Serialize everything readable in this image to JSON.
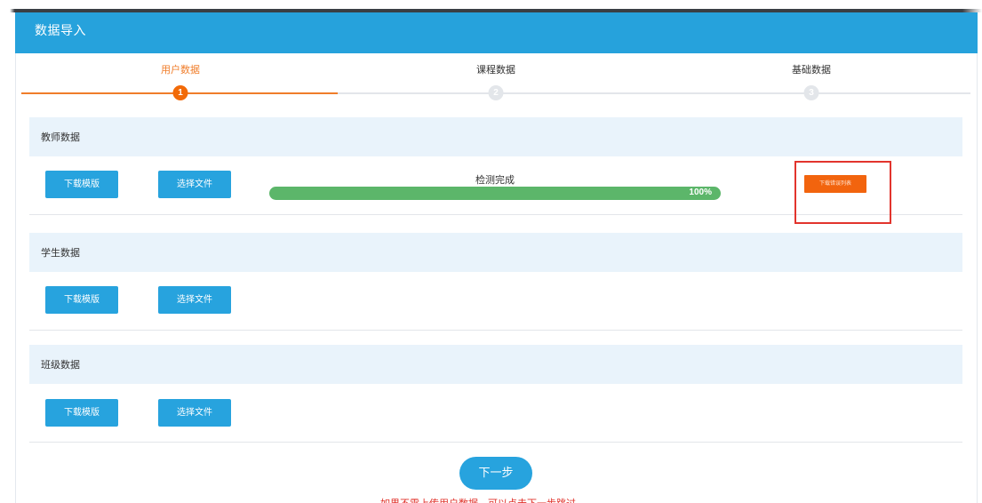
{
  "header": {
    "title": "数据导入"
  },
  "stepper": {
    "steps": [
      {
        "label": "用户数据",
        "number": "1",
        "active": true
      },
      {
        "label": "课程数据",
        "number": "2",
        "active": false
      },
      {
        "label": "基础数据",
        "number": "3",
        "active": false
      }
    ]
  },
  "sections": [
    {
      "title": "教师数据",
      "download_label": "下载模版",
      "select_label": "选择文件",
      "status_label": "检测完成",
      "progress_text": "100%",
      "progress": 1.0,
      "error_button_label": "下载错误列表"
    },
    {
      "title": "学生数据",
      "download_label": "下载模版",
      "select_label": "选择文件"
    },
    {
      "title": "班级数据",
      "download_label": "下载模版",
      "select_label": "选择文件"
    }
  ],
  "footer": {
    "next_label": "下一步",
    "hint": "如果不需上传用户数据，可以点击下一步跳过"
  },
  "colors": {
    "header_blue": "#26a2dc",
    "accent_orange": "#f26a08",
    "progress_green": "#5cb66a",
    "highlight_red": "#e2342d"
  }
}
